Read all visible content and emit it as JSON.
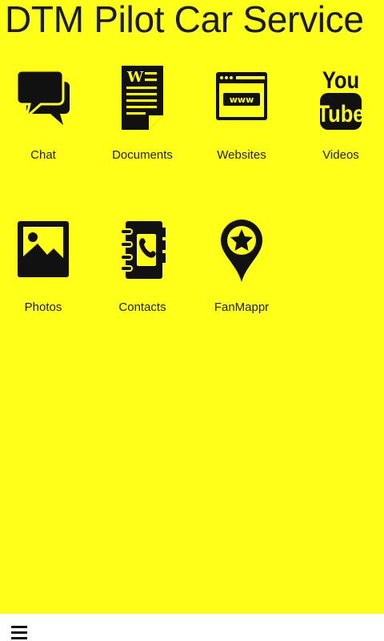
{
  "header": {
    "title": "DTM Pilot Car Service"
  },
  "grid": {
    "items": [
      {
        "label": "Chat",
        "icon": "chat-icon"
      },
      {
        "label": "Documents",
        "icon": "document-icon"
      },
      {
        "label": "Websites",
        "icon": "web-browser-icon"
      },
      {
        "label": "Videos",
        "icon": "youtube-icon"
      },
      {
        "label": "Photos",
        "icon": "photo-icon"
      },
      {
        "label": "Contacts",
        "icon": "contacts-book-icon"
      },
      {
        "label": "FanMappr",
        "icon": "map-pin-star-icon"
      }
    ],
    "youtube_top": "You",
    "youtube_bottom": "Tube",
    "www_text": "www",
    "doc_letter": "W"
  },
  "bottom_bar": {
    "menu_icon": "hamburger-menu-icon"
  },
  "colors": {
    "background": "#FFFF1A",
    "icon": "#111111",
    "bottom_bar": "#FFFFFF"
  }
}
